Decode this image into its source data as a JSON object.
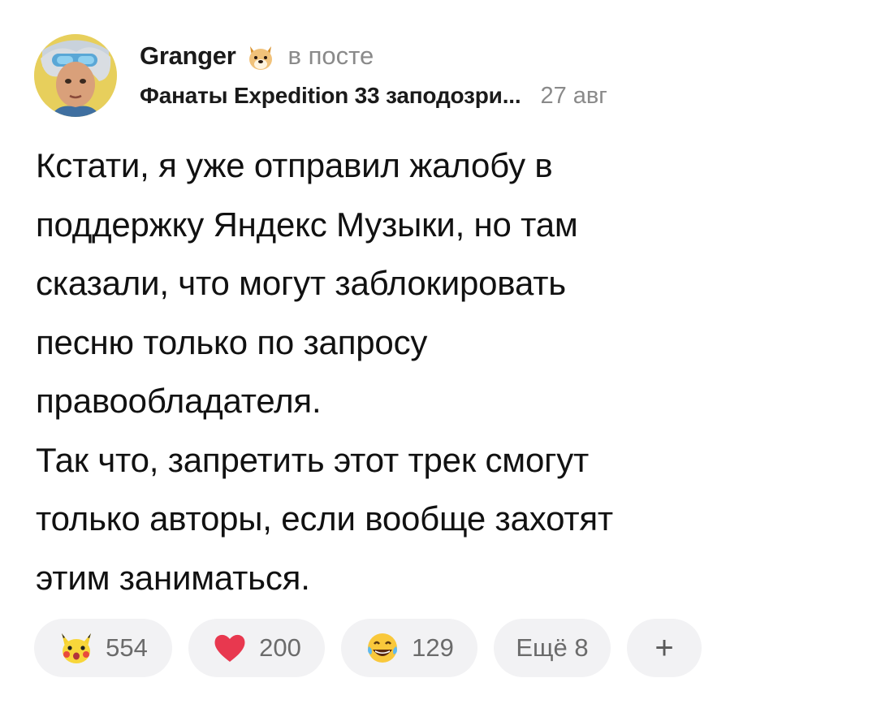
{
  "comment": {
    "author": "Granger",
    "context_label": "в посте",
    "post_title": "Фанаты Expedition 33 заподозри...",
    "date": "27 авг",
    "text": "Кстати, я уже отправил жалобу в\nподдержку Яндекс Музыки, но там\nсказали, что могут заблокировать\nпесню только по запросу\nправообладателя.\nТак что, запретить этот трек смогут\nтолько авторы, если вообще захотят\nэтим заниматься."
  },
  "reactions": [
    {
      "icon": "pikachu-emoji-icon",
      "count": "554"
    },
    {
      "icon": "heart-emoji-icon",
      "count": "200"
    },
    {
      "icon": "laughing-tears-emoji-icon",
      "count": "129"
    }
  ],
  "more_reactions_label": "Ещё 8",
  "add_reaction_label": "+",
  "colors": {
    "text": "#111111",
    "muted": "#8a8a8a",
    "pill_bg": "#f2f2f4",
    "heart": "#e8384f"
  }
}
